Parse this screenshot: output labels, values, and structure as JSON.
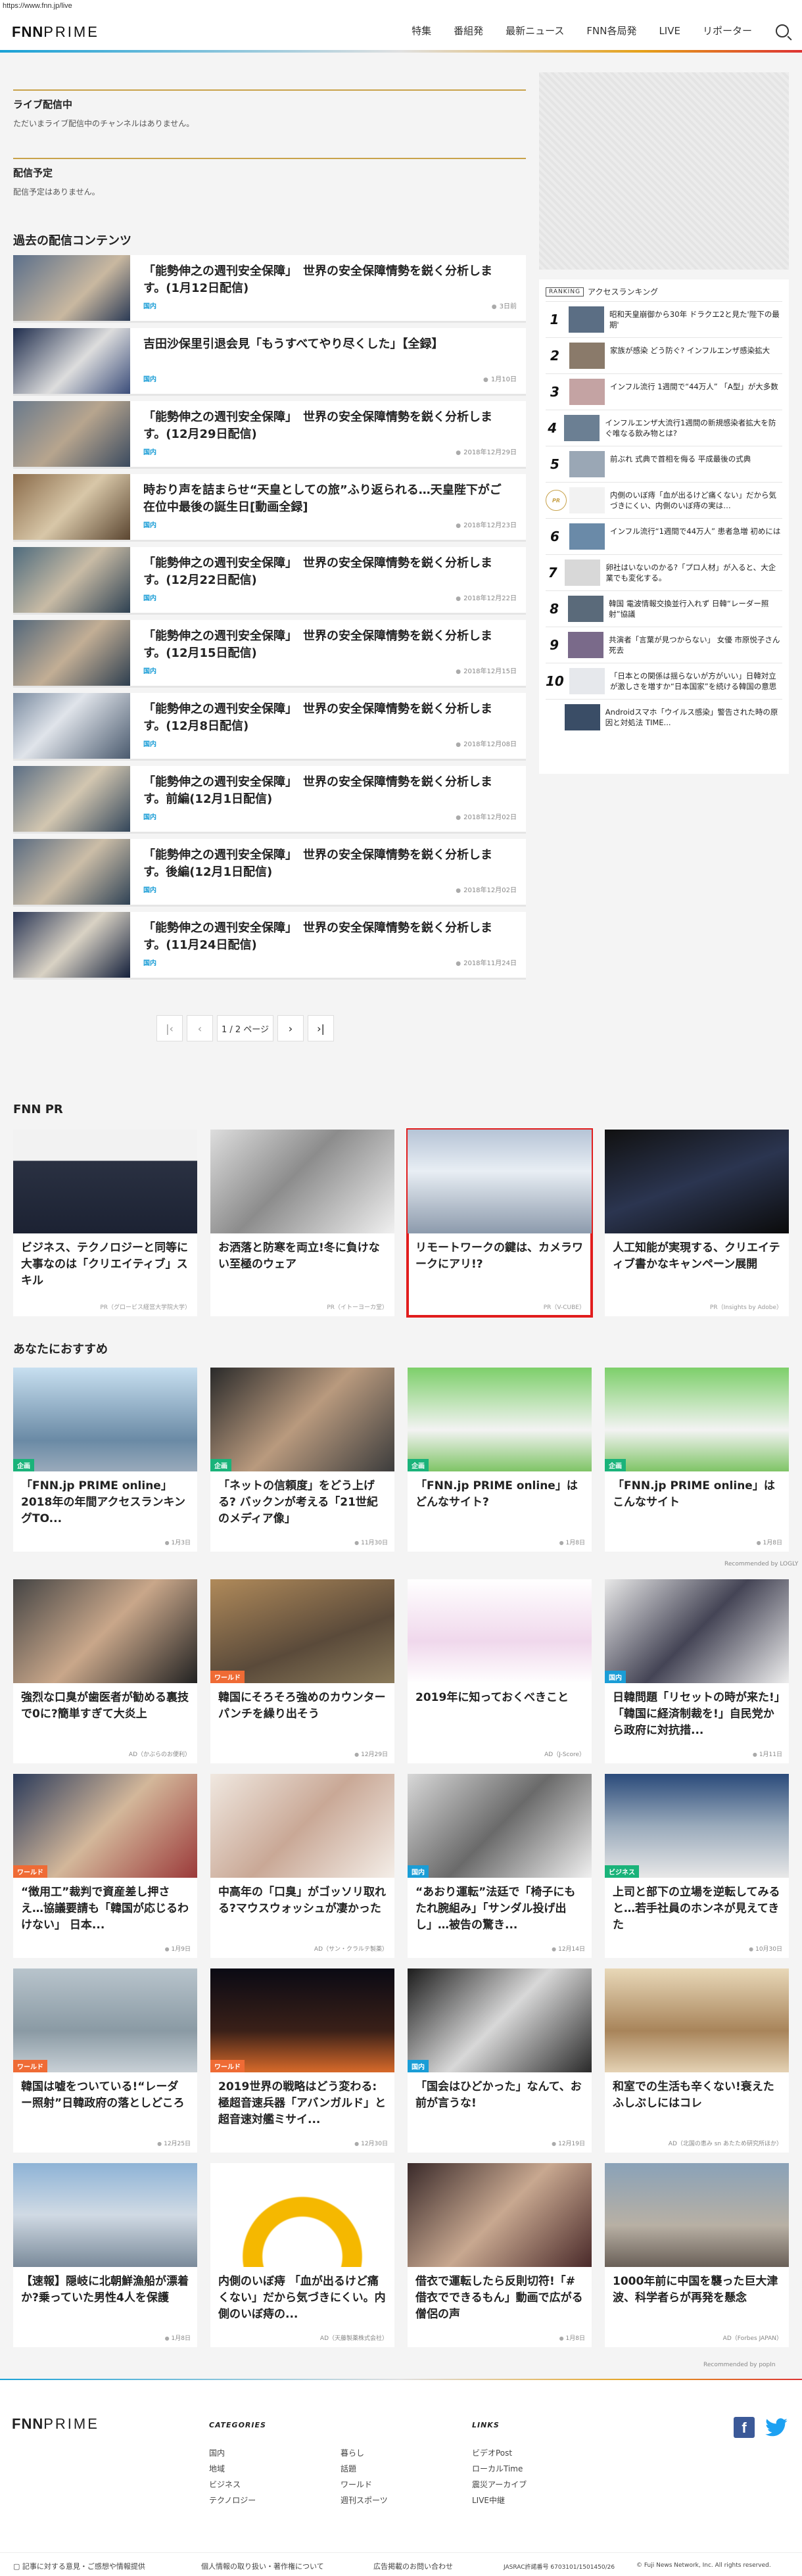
{
  "url": "https://www.fnn.jp/live",
  "brand": {
    "logo_fnn": "FNN",
    "logo_prime": "PRIME"
  },
  "nav": [
    "特集",
    "番組発",
    "最新ニュース",
    "FNN各局発",
    "LIVE",
    "リポーター"
  ],
  "live": {
    "title": "ライブ配信中",
    "text": "ただいまライブ配信中のチャンネルはありません。"
  },
  "scheduled": {
    "title": "配信予定",
    "text": "配信予定はありません。"
  },
  "past": {
    "title": "過去の配信コンテンツ",
    "items": [
      {
        "title": "「能勢伸之の週刊安全保障」　世界の安全保障情勢を鋭く分析します。(1月12日配信)",
        "cat": "国内",
        "date": "3日前"
      },
      {
        "title": "吉田沙保里引退会見「もうすべてやり尽くした」【全録】",
        "cat": "国内",
        "date": "1月10日"
      },
      {
        "title": "「能勢伸之の週刊安全保障」　世界の安全保障情勢を鋭く分析します。(12月29日配信)",
        "cat": "国内",
        "date": "2018年12月29日"
      },
      {
        "title": "時おり声を詰まらせ“天皇としての旅”ふり返られる…天皇陛下がご在位中最後の誕生日[動画全録]",
        "cat": "国内",
        "date": "2018年12月23日"
      },
      {
        "title": "「能勢伸之の週刊安全保障」　世界の安全保障情勢を鋭く分析します。(12月22日配信)",
        "cat": "国内",
        "date": "2018年12月22日"
      },
      {
        "title": "「能勢伸之の週刊安全保障」　世界の安全保障情勢を鋭く分析します。(12月15日配信)",
        "cat": "国内",
        "date": "2018年12月15日"
      },
      {
        "title": "「能勢伸之の週刊安全保障」　世界の安全保障情勢を鋭く分析します。(12月8日配信)",
        "cat": "国内",
        "date": "2018年12月08日"
      },
      {
        "title": "「能勢伸之の週刊安全保障」　世界の安全保障情勢を鋭く分析します。前編(12月1日配信)",
        "cat": "国内",
        "date": "2018年12月02日"
      },
      {
        "title": "「能勢伸之の週刊安全保障」　世界の安全保障情勢を鋭く分析します。後編(12月1日配信)",
        "cat": "国内",
        "date": "2018年12月02日"
      },
      {
        "title": "「能勢伸之の週刊安全保障」　世界の安全保障情勢を鋭く分析します。(11月24日配信)",
        "cat": "国内",
        "date": "2018年11月24日"
      }
    ]
  },
  "pager": {
    "first": "|‹",
    "prev": "‹",
    "info": "1 / 2 ページ",
    "next": "›",
    "last": "›|"
  },
  "ranking": {
    "tag": "RANKING",
    "title": "アクセスランキング",
    "items": [
      {
        "num": "1",
        "title": "昭和天皇崩御から30年 ドラクエ2と見た'陛下の最期'"
      },
      {
        "num": "2",
        "title": "家族が感染 どう防ぐ? インフルエンザ感染拡大"
      },
      {
        "num": "3",
        "title": "インフル流行 1週間で“44万人” 「A型」が大多数"
      },
      {
        "num": "4",
        "title": "インフルエンザ大流行1週間の新規感染者拡大を防ぐ唯なる飲み物とは?"
      },
      {
        "num": "5",
        "title": "前ぶれ 式典で首相を侮る 平成最後の式典"
      },
      {
        "num": "PR",
        "title": "内側のいぼ痔「血が出るけど痛くない」だから気づきにくい、内側のいぼ痔の実は…"
      },
      {
        "num": "6",
        "title": "インフル流行“1週間で44万人” 患者急増 初めには"
      },
      {
        "num": "7",
        "title": "卵社はいないのかる?「プロ人材」が入ると、大企業でも変化する。"
      },
      {
        "num": "8",
        "title": "韓国 電波情報交換並行入れず 日韓“レーダー照射”協議"
      },
      {
        "num": "9",
        "title": "共演者「言葉が見つからない」 女優 市原悦子さん死去"
      },
      {
        "num": "10",
        "title": "「日本との関係は揺らないが方がいい」日韓対立が激しさを増すか“日本国家”を続ける韓国の意思とは?"
      },
      {
        "num": "",
        "title": "Androidスマホ「ウイルス感染」警告された時の原因と対処法 TIME..."
      }
    ]
  },
  "fnnpr": {
    "title": "FNN PR",
    "items": [
      {
        "title": "ビジネス、テクノロジーと同等に大事なのは「クリエイティブ」スキル",
        "src": "PR（グロービス経営大学院大学）"
      },
      {
        "title": "お洒落と防寒を両立!冬に負けない至極のウェア",
        "src": "PR（イトーヨーカ堂）"
      },
      {
        "title": "リモートワークの鍵は、カメラワークにアリ!?",
        "src": "PR（V-CUBE）"
      },
      {
        "title": "人工知能が実現する、クリエイティブ書かなキャンペーン展開",
        "src": "PR（Insights by Adobe）"
      }
    ]
  },
  "recommend": {
    "title": "あなたにおすすめ",
    "row1": [
      {
        "title": "「FNN.jp PRIME online」2018年の年間アクセスランキングTO...",
        "badge": "企画",
        "date": "1月3日"
      },
      {
        "title": "「ネットの信頼度」をどう上げる? バックンが考える「21世紀のメディア像」",
        "badge": "企画",
        "date": "11月30日"
      },
      {
        "title": "「FNN.jp PRIME online」はどんなサイト?",
        "badge": "企画",
        "date": "1月8日"
      },
      {
        "title": "「FNN.jp PRIME online」はこんなサイト",
        "badge": "企画",
        "date": "1月8日"
      }
    ],
    "logly": "Recommended by LOGLY",
    "row2": [
      {
        "title": "強烈な口臭が歯医者が勧める裏技で0に?簡単すぎて大炎上",
        "badge": "",
        "src": "AD（かぶらのお便利）"
      },
      {
        "title": "韓国にそろそろ強めのカウンターパンチを繰り出そう",
        "badge": "ワールド",
        "date": "12月29日"
      },
      {
        "title": "2019年に知っておくべきこと",
        "badge": "",
        "src": "AD（J-Score）"
      },
      {
        "title": "日韓問題「リセットの時が来た!」「韓国に経済制裁を!」自民党から政府に対抗措...",
        "badge": "国内",
        "date": "1月11日"
      }
    ],
    "row3": [
      {
        "title": "“徴用工”裁判で資産差し押さえ…協議要請も「韓国が応じるわけない」 日本...",
        "badge": "ワールド",
        "date": "1月9日"
      },
      {
        "title": "中高年の「口臭」がゴッソリ取れる?マウスウォッシュが凄かった",
        "badge": "",
        "src": "AD（サン・クラルテ製薬）"
      },
      {
        "title": "“あおり運転”法廷で「椅子にもたれ腕組み」「サンダル投げ出し」…被告の驚き...",
        "badge": "国内",
        "date": "12月14日"
      },
      {
        "title": "上司と部下の立場を逆転してみると…若手社員のホンネが見えてきた",
        "badge": "ビジネス",
        "date": "10月30日"
      }
    ],
    "row4": [
      {
        "title": "韓国は嘘をついている!“レーダー照射”日韓政府の落としどころ",
        "badge": "ワールド",
        "date": "12月25日"
      },
      {
        "title": "2019世界の戦略はどう変わる:極超音速兵器「アバンガルド」と超音速対艦ミサイ...",
        "badge": "ワールド",
        "date": "12月30日"
      },
      {
        "title": "「国会はひどかった」なんて、お前が言うな!",
        "badge": "国内",
        "date": "12月19日"
      },
      {
        "title": "和室での生活も辛くない!衰えたふしぶしにはコレ",
        "badge": "",
        "src": "AD（北国の恵み sn あたため研究所ほか）"
      }
    ],
    "row5": [
      {
        "title": "【速報】隠岐に北朝鮮漁船が漂着か?乗っていた男性4人を保護",
        "badge": "",
        "date": "1月8日"
      },
      {
        "title": "内側のいぼ痔 「血が出るけど痛くない」だから気づきにくい。内側のいぼ痔の...",
        "badge": "",
        "src": "AD（天藤製薬株式会社）"
      },
      {
        "title": "借衣で運転したら反則切符!「#借衣でできるもん」動画で広がる僧侶の声",
        "badge": "",
        "date": "1月8日"
      },
      {
        "title": "1000年前に中国を襲った巨大津波、科学者らが再発を懸念",
        "badge": "",
        "src": "AD（Forbes JAPAN）"
      }
    ],
    "popin": "Recommended by popIn"
  },
  "footer": {
    "categories_head": "CATEGORIES",
    "links_head": "LINKS",
    "col1": [
      "国内",
      "地域",
      "ビジネス",
      "テクノロジー"
    ],
    "col2": [
      "暮らし",
      "話題",
      "ワールド",
      "週刊スポーツ"
    ],
    "col3": [
      "ビデオPost",
      "ローカルTime",
      "震災アーカイブ",
      "LIVE中継"
    ],
    "bottom": [
      "記事に対する意見・ご感想や情報提供",
      "個人情報の取り扱い・著作権について",
      "広告掲載のお問い合わせ",
      "JASRAC許諾番号 6703101/1501450/26",
      "© Fuji News Network, Inc. All rights reserved."
    ]
  },
  "colors": {
    "accent": "#1a9dd6",
    "gold": "#c8a24a",
    "green_badge": "#1ab37a",
    "highlight": "#e11d1d"
  }
}
